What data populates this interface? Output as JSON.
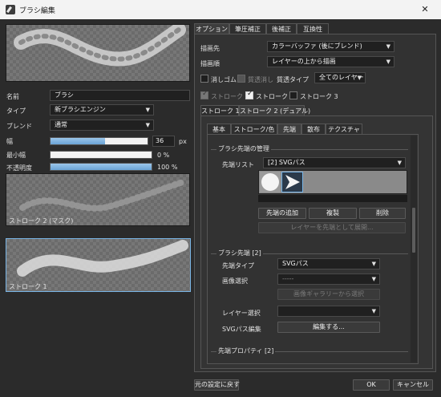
{
  "window": {
    "title": "ブラシ編集"
  },
  "left": {
    "name_label": "名前",
    "name_value": "ブラシ",
    "type_label": "タイプ",
    "type_value": "新ブラシエンジン",
    "blend_label": "ブレンド",
    "blend_value": "通常",
    "width_label": "幅",
    "width_value": "36",
    "width_unit": "px",
    "width_fraction": 0.56,
    "minwidth_label": "最小幅",
    "minwidth_value": "0 %",
    "minwidth_fraction": 0.0,
    "opacity_label": "不透明度",
    "opacity_value": "100 %",
    "opacity_fraction": 1.0,
    "preview2_label": "ストローク 2 (マスク)",
    "preview1_label": "ストローク 1",
    "reset_button": "元の設定に戻す"
  },
  "tabs_top": [
    "オプション",
    "筆圧補正",
    "後補正",
    "互換性"
  ],
  "options": {
    "draw_target_label": "描画先",
    "draw_target_value": "カラーバッファ (後にブレンド)",
    "draw_order_label": "描画順",
    "draw_order_value": "レイヤーの上から描画",
    "eraser_label": "消しゴム",
    "transparent_eraser_label": "質透消し",
    "lock_type_label": "質透タイプ",
    "lock_type_value": "全てのレイヤー"
  },
  "stroke_checks": [
    "ストローク 1",
    "ストローク 2",
    "ストローク 3"
  ],
  "stroke_tabs": [
    "ストローク 1",
    "ストローク 2 (デュアル)"
  ],
  "inner_tabs": [
    "基本",
    "ストローク/色",
    "先端",
    "散布",
    "テクスチャ"
  ],
  "tip_manage": {
    "group_title": "ブラシ先端の管理",
    "list_label": "先端リスト",
    "list_value": "[2] SVGパス",
    "add_button": "先端の追加",
    "copy_button": "複製",
    "delete_button": "削除",
    "layer_button": "レイヤーを先端として展開..."
  },
  "tip2": {
    "group_title": "ブラシ先端 [2]",
    "type_label": "先端タイプ",
    "type_value": "SVGパス",
    "image_label": "画像選択",
    "image_value": "-----",
    "gallery_button": "画像ギャラリーから選択",
    "layer_label": "レイヤー選択",
    "svg_label": "SVGパス編集",
    "svg_button": "編集する..."
  },
  "tip_property": {
    "group_title": "先端プロパティ [2]"
  },
  "footer": {
    "ok_button": "OK",
    "cancel_button": "キャンセル"
  },
  "icons": {
    "close": "close-icon",
    "dropdown": "chevron-down-icon"
  }
}
